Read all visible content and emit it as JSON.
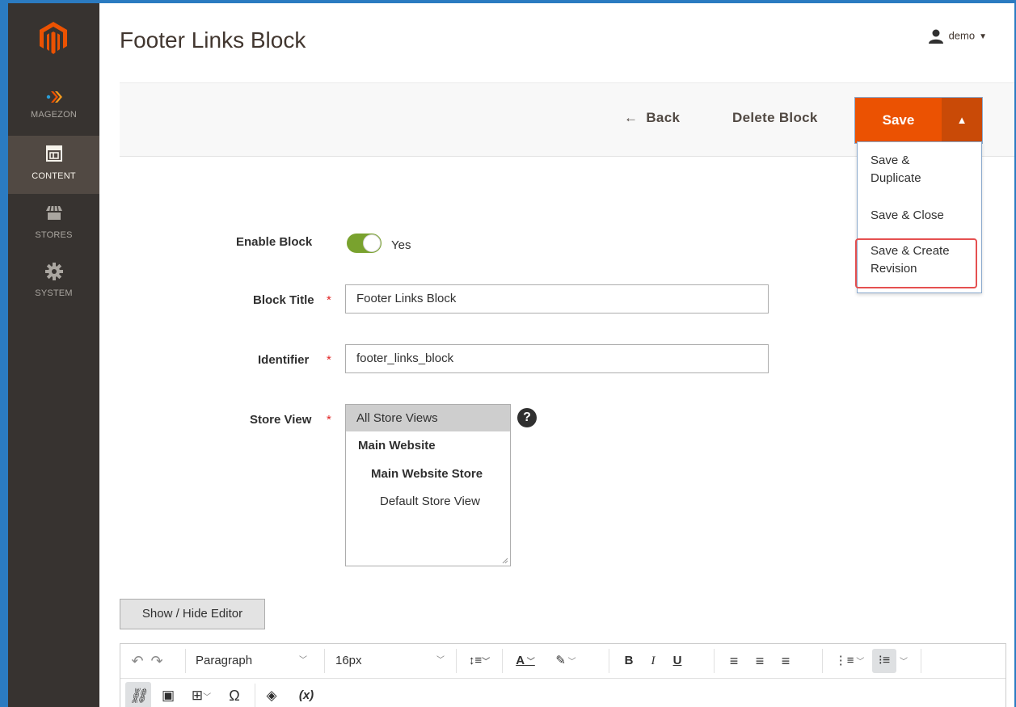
{
  "sidebar": {
    "logo_icon": "magento-logo-icon",
    "items": [
      {
        "label": "MAGEZON",
        "icon": "magezon-icon"
      },
      {
        "label": "CONTENT",
        "icon": "content-icon",
        "active": true
      },
      {
        "label": "STORES",
        "icon": "stores-icon"
      },
      {
        "label": "SYSTEM",
        "icon": "gear-icon"
      }
    ]
  },
  "header": {
    "title": "Footer Links Block",
    "user": "demo"
  },
  "actions": {
    "back_label": "Back",
    "delete_label": "Delete Block",
    "save_label": "Save",
    "dropdown": [
      "Save & Duplicate",
      "Save & Close",
      "Save & Create Revision"
    ]
  },
  "form": {
    "enable_label": "Enable Block",
    "enable_value": "Yes",
    "title_label": "Block Title",
    "title_value": "Footer Links Block",
    "identifier_label": "Identifier",
    "identifier_value": "footer_links_block",
    "store_view_label": "Store View",
    "store_options": [
      "All Store Views",
      "Main Website",
      "Main Website Store",
      "Default Store View"
    ]
  },
  "editor": {
    "toggle_label": "Show / Hide Editor",
    "block_format": "Paragraph",
    "font_size": "16px",
    "variable_label": "(x)"
  },
  "colors": {
    "sidebar": "#373330",
    "save": "#eb5202",
    "toggle_on": "#79a22e",
    "highlight": "#e55050"
  }
}
